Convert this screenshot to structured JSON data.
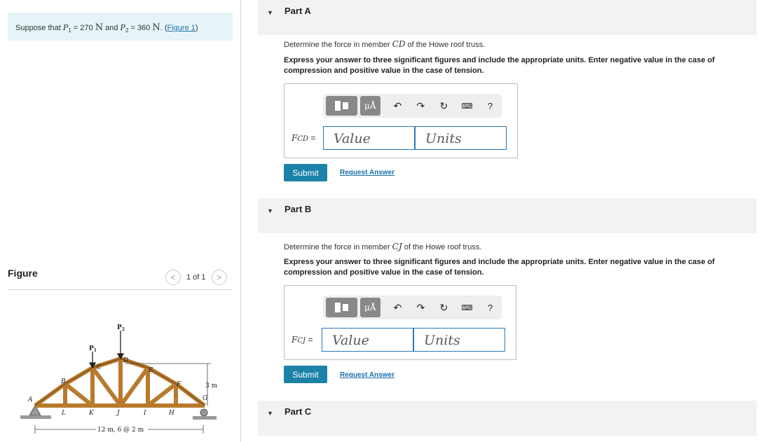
{
  "problem": {
    "prefix": "Suppose that ",
    "p1": "P",
    "p1_sub": "1",
    "eq1": " = 270 ",
    "unit1": "N",
    "and": " and ",
    "p2": "P",
    "p2_sub": "2",
    "eq2": " = 360 ",
    "unit2": "N",
    "dot": ". (",
    "link": "Figure 1",
    "close": ")"
  },
  "figure": {
    "label": "Figure",
    "pager_text": "1 of 1",
    "prev_label": "<",
    "next_label": ">",
    "loads": [
      "P1",
      "P2"
    ],
    "joints_top": [
      "A",
      "B",
      "C",
      "D",
      "E",
      "F",
      "G"
    ],
    "joints_bottom": [
      "L",
      "K",
      "J",
      "I",
      "H"
    ],
    "height_label": "3 m",
    "span_label": "12 m, 6 @ 2 m"
  },
  "parts": [
    {
      "title": "Part A",
      "question_pre": "Determine the force in member ",
      "member": "CD",
      "question_post": " of the Howe roof truss.",
      "instructions": "Express your answer to three significant figures and include the appropriate units. Enter negative value in the case of compression and positive value in the case of tension.",
      "field_label_var": "F",
      "field_label_sub": "CD",
      "field_label_eq": " =",
      "value_placeholder": "Value",
      "units_placeholder": "Units",
      "submit": "Submit",
      "request": "Request Answer"
    },
    {
      "title": "Part B",
      "question_pre": "Determine the force in member ",
      "member": "CJ",
      "question_post": " of the Howe roof truss.",
      "instructions": "Express your answer to three significant figures and include the appropriate units. Enter negative value in the case of compression and positive value in the case of tension.",
      "field_label_var": "F",
      "field_label_sub": "CJ",
      "field_label_eq": " =",
      "value_placeholder": "Value",
      "units_placeholder": "Units",
      "submit": "Submit",
      "request": "Request Answer"
    },
    {
      "title": "Part C"
    }
  ],
  "toolbar": {
    "mu_label": "μÅ",
    "help": "?"
  }
}
